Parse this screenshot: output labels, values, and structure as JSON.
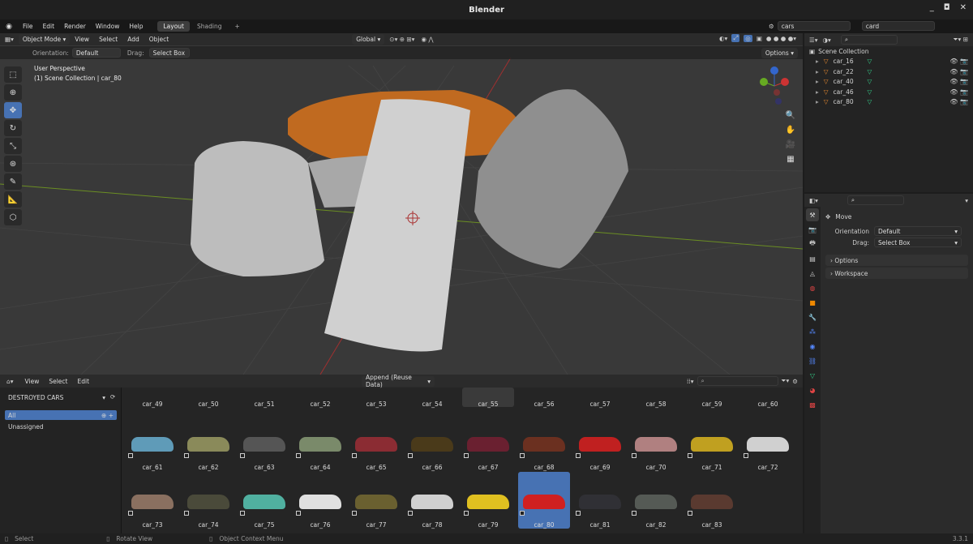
{
  "title": "Blender",
  "window_controls": [
    "_",
    "◘",
    "✕"
  ],
  "menu": {
    "items": [
      "File",
      "Edit",
      "Render",
      "Window",
      "Help"
    ],
    "tabs": [
      "Layout",
      "Shading"
    ],
    "active_tab": "Layout",
    "add_tab": "+",
    "scene_field": "cars",
    "viewlayer_field": "card"
  },
  "viewport": {
    "mode": "Object Mode",
    "menus": [
      "View",
      "Select",
      "Add",
      "Object"
    ],
    "orientation_label": "Orientation:",
    "orientation": "Default",
    "drag_label": "Drag:",
    "drag": "Select Box",
    "transform": "Global",
    "options": "Options",
    "info_line1": "User Perspective",
    "info_line2": "(1) Scene Collection | car_80",
    "gizmo": {
      "x": "X",
      "y": "Y",
      "z": "Z"
    }
  },
  "asset_browser": {
    "menus": [
      "View",
      "Select",
      "Edit"
    ],
    "import_mode": "Append (Reuse Data)",
    "library": "DESTROYED CARS",
    "catalogs": [
      "All",
      "Unassigned"
    ],
    "selected": "car_80",
    "row_labels_top": [
      "car_49",
      "car_50",
      "car_51",
      "car_52",
      "car_53",
      "car_54",
      "car_55",
      "car_56",
      "car_57",
      "car_58",
      "car_59",
      "car_60"
    ],
    "row1": [
      "car_61",
      "car_62",
      "car_63",
      "car_64",
      "car_65",
      "car_66",
      "car_67",
      "car_68",
      "car_69",
      "car_70",
      "car_71",
      "car_72"
    ],
    "row2": [
      "car_73",
      "car_74",
      "car_75",
      "car_76",
      "car_77",
      "car_78",
      "car_79",
      "car_80",
      "car_81",
      "car_82",
      "car_83"
    ],
    "row1_colors": [
      "#5f9bb8",
      "#8a8a5a",
      "#555",
      "#7a8a6a",
      "#8b2c33",
      "#4a3a1a",
      "#6a2030",
      "#6b3020",
      "#c02020",
      "#b08080",
      "#c0a020",
      "#d0d0d0"
    ],
    "row2_colors": [
      "#8a7060",
      "#4a4a3a",
      "#50b0a0",
      "#e0e0e0",
      "#6a6030",
      "#d0d0d0",
      "#e0c020",
      "#d02020",
      "#303035",
      "#555a55",
      "#5a3a30"
    ]
  },
  "outliner": {
    "root": "Scene Collection",
    "items": [
      "car_16",
      "car_22",
      "car_40",
      "car_46",
      "car_80"
    ]
  },
  "properties": {
    "tool": "Move",
    "orientation_label": "Orientation",
    "orientation": "Default",
    "drag_label": "Drag:",
    "drag": "Select Box",
    "panels": [
      "Options",
      "Workspace"
    ]
  },
  "status": {
    "items": [
      "Select",
      "Rotate View",
      "Object Context Menu"
    ],
    "version": "3.3.1"
  },
  "colors": {
    "accent": "#4772b3",
    "selected_object": "#c06a20"
  }
}
